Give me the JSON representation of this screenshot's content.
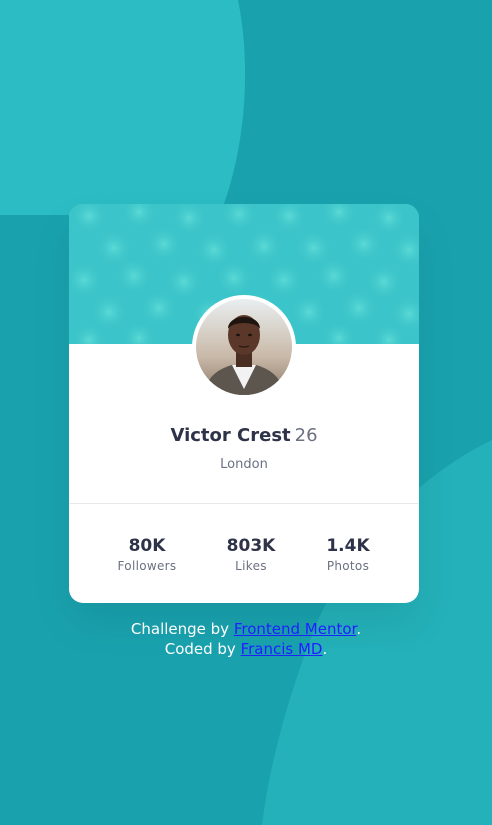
{
  "colors": {
    "background": "#19a2ae",
    "background_shape": "#2cbcc3",
    "card": "#ffffff",
    "header": "#3bc4c9",
    "text_dark": "#2e3349",
    "text_gray": "#6b7082",
    "link": "#2020ff"
  },
  "profile": {
    "name": "Victor Crest",
    "age": "26",
    "location": "London",
    "avatar_icon": "profile-photo"
  },
  "stats": [
    {
      "value": "80K",
      "label": "Followers"
    },
    {
      "value": "803K",
      "label": "Likes"
    },
    {
      "value": "1.4K",
      "label": "Photos"
    }
  ],
  "attribution": {
    "challenge_prefix": "Challenge by ",
    "challenge_link": "Frontend Mentor",
    "challenge_suffix": ".",
    "coded_prefix": "Coded by ",
    "coded_link": "Francis MD",
    "coded_suffix": "."
  }
}
